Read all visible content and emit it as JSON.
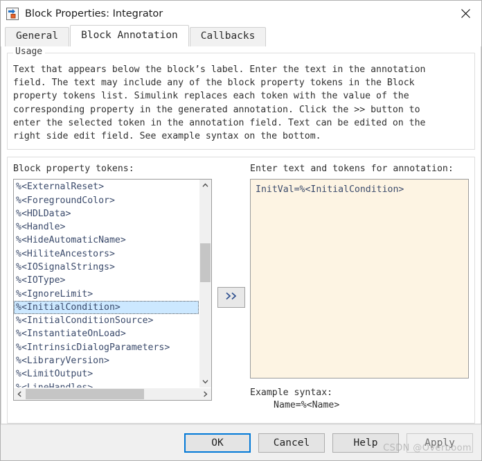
{
  "window": {
    "title": "Block Properties: Integrator",
    "icon": "simulink-block-icon",
    "close_label": "✕"
  },
  "tabs": [
    {
      "label": "General",
      "active": false
    },
    {
      "label": "Block Annotation",
      "active": true
    },
    {
      "label": "Callbacks",
      "active": false
    }
  ],
  "usage": {
    "legend": "Usage",
    "text": "Text that appears below the block’s label. Enter the text in the annotation\nfield. The text may include any of the block property tokens in the Block\nproperty tokens list. Simulink replaces each token with the value of the\ncorresponding property in the generated annotation. Click the >> button to\nenter the selected token in the annotation field. Text can be edited on the\nright side edit field. See example syntax on the bottom."
  },
  "tokens_panel": {
    "label": "Block property tokens:",
    "items": [
      "%<ExternalReset>",
      "%<ForegroundColor>",
      "%<HDLData>",
      "%<Handle>",
      "%<HideAutomaticName>",
      "%<HiliteAncestors>",
      "%<IOSignalStrings>",
      "%<IOType>",
      "%<IgnoreLimit>",
      "%<InitialCondition>",
      "%<InitialConditionSource>",
      "%<InstantiateOnLoad>",
      "%<IntrinsicDialogParameters>",
      "%<LibraryVersion>",
      "%<LimitOutput>",
      "%<LineHandles>"
    ],
    "selected_index": 9,
    "scroll_up_icon": "chevron-up-icon",
    "scroll_down_icon": "chevron-down-icon",
    "scroll_left_icon": "chevron-left-icon",
    "scroll_right_icon": "chevron-right-icon"
  },
  "transfer": {
    "label": ">>",
    "icon": "double-chevron-right-icon"
  },
  "annotation_panel": {
    "label": "Enter text and tokens for annotation:",
    "value": "InitVal=%<InitialCondition>",
    "background_color": "#fdf4e3"
  },
  "example": {
    "line1": "Example syntax:",
    "line2": "Name=%<Name>"
  },
  "footer": {
    "buttons": [
      {
        "label": "OK",
        "state": "primary"
      },
      {
        "label": "Cancel",
        "state": "normal"
      },
      {
        "label": "Help",
        "state": "normal"
      },
      {
        "label": "Apply",
        "state": "disabled"
      }
    ]
  },
  "watermark": {
    "text": "CSDN @Overboom"
  },
  "colors": {
    "selection": "#cce8ff",
    "focus_border": "#0078d7",
    "token_text": "#3a4a6b",
    "annotation_bg": "#fdf4e3"
  }
}
